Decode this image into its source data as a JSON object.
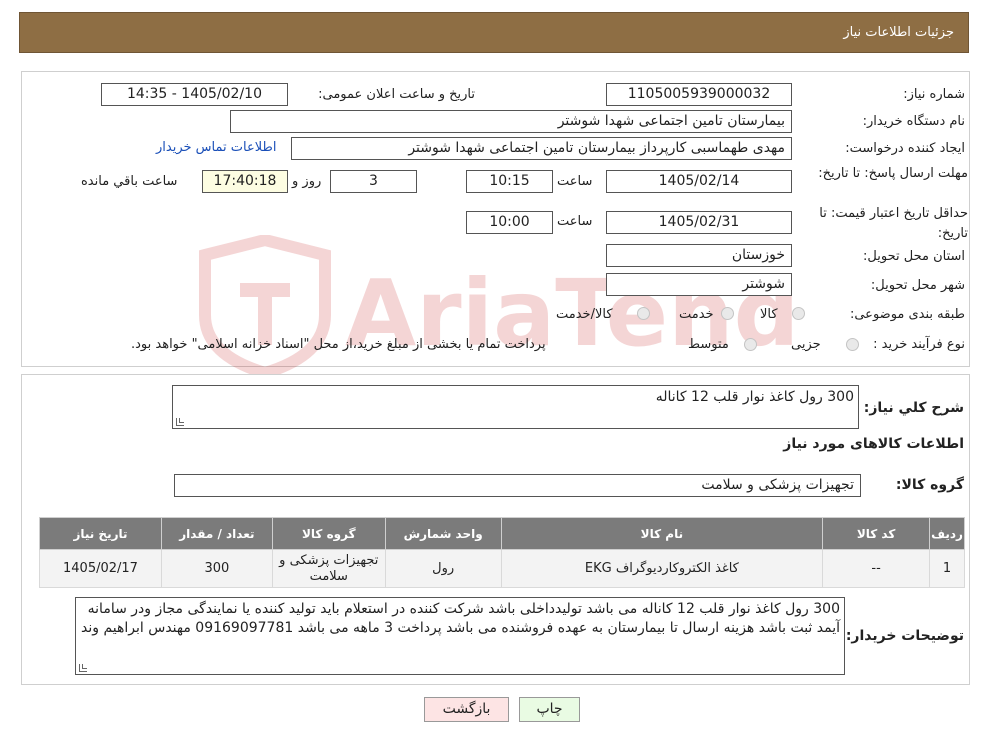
{
  "header": {
    "title": "جزئیات اطلاعات نیاز"
  },
  "form": {
    "need_number_label": "شماره نیاز:",
    "need_number": "1105005939000032",
    "announce_label": "تاریخ و ساعت اعلان عمومی:",
    "announce_value": "1405/02/10 - 14:35",
    "buyer_org_label": "نام دستگاه خریدار:",
    "buyer_org": "بیمارستان تامین اجتماعی شهدا شوشتر",
    "creator_label": "ایجاد کننده درخواست:",
    "creator": "مهدی طهماسبی کارپرداز بیمارستان تامین اجتماعی شهدا شوشتر",
    "contact_link": "اطلاعات تماس خریدار",
    "deadline_label": "مهلت ارسال پاسخ: تا تاریخ:",
    "deadline_date": "1405/02/14",
    "time_word": "ساعت",
    "deadline_time": "10:15",
    "days_left": "3",
    "days_word": "روز و",
    "remaining_time": "17:40:18",
    "remaining_word": "ساعت باقي مانده",
    "validity_label": "حداقل تاریخ اعتبار قیمت: تا تاریخ:",
    "validity_date": "1405/02/31",
    "validity_time": "10:00",
    "province_label": "استان محل تحویل:",
    "province": "خوزستان",
    "city_label": "شهر محل تحویل:",
    "city": "شوشتر",
    "category_label": "طبقه بندی موضوعی:",
    "category_options": [
      "کالا",
      "خدمت",
      "کالا/خدمت"
    ],
    "process_label": "نوع فرآیند خرید :",
    "process_options": [
      "جزیی",
      "متوسط"
    ],
    "process_note": "پرداخت تمام یا بخشی از مبلغ خرید،از محل \"اسناد خزانه اسلامی\" خواهد بود."
  },
  "details": {
    "summary_label": "شرح کلي نیاز:",
    "summary": "300 رول کاغذ نوار قلب 12 کاناله",
    "goods_info_title": "اطلاعات کالاهای مورد نیاز",
    "goods_group_label": "گروه کالا:",
    "goods_group": "تجهیزات پزشکی و سلامت",
    "table": {
      "headers": [
        "ردیف",
        "کد کالا",
        "نام کالا",
        "واحد شمارش",
        "گروه کالا",
        "تعداد / مقدار",
        "تاریخ نیاز"
      ],
      "rows": [
        [
          "1",
          "--",
          "کاغذ الکتروکاردیوگراف EKG",
          "رول",
          "تجهیزات پزشکی و سلامت",
          "300",
          "1405/02/17"
        ]
      ]
    },
    "buyer_notes_label": "توضیحات خریدار:",
    "buyer_notes": "300 رول کاغذ نوار قلب 12 کاناله می باشد تولیدداخلی باشد شرکت کننده در استعلام باید تولید کننده یا نمایندگی مجاز ودر سامانه آیمد ثبت باشد هزینه ارسال تا بیمارستان به عهده فروشنده می باشد پرداخت 3 ماهه می باشد 09169097781 مهندس ابراهیم وند"
  },
  "buttons": {
    "print": "چاپ",
    "back": "بازگشت"
  },
  "watermark": {
    "text": "AriaTender.neT"
  },
  "colors": {
    "header_bg": "#8e6e44",
    "table_header_bg": "#7b7b7b",
    "link": "#1a4fb8",
    "back_button_bg": "#fde4e4",
    "print_button_bg": "#e9fbe3"
  }
}
